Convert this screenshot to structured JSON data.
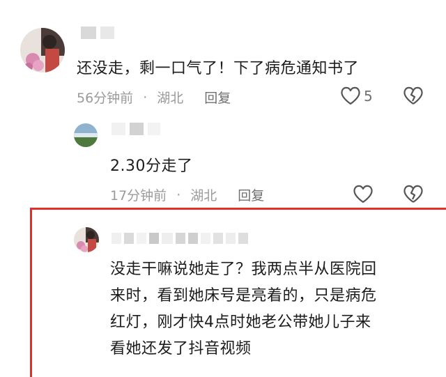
{
  "comments": [
    {
      "text": "还没走，剩一口气了！下了病危通知书了",
      "time": "56分钟前",
      "dot": "·",
      "location": "湖北",
      "reply_label": "回复",
      "like_count": "5",
      "avatar_icon": "flower-avatar-icon"
    },
    {
      "text": "2.30分走了",
      "time": "17分钟前",
      "dot": "·",
      "location": "湖北",
      "reply_label": "回复",
      "like_count": "",
      "avatar_icon": "landscape-avatar-icon"
    },
    {
      "text_lines": [
        "没走干嘛说她走了？我两点半从医院回",
        "来时，看到她床号是亮着的，只是病危",
        "红灯，刚才快4点时她老公带她儿子来",
        "看她还发了抖音视频"
      ],
      "avatar_icon": "flower-avatar-icon"
    }
  ],
  "colors": {
    "highlight_border": "#e0302a",
    "meta_text": "#9a9a9a",
    "body_text": "#1c1c1c"
  }
}
